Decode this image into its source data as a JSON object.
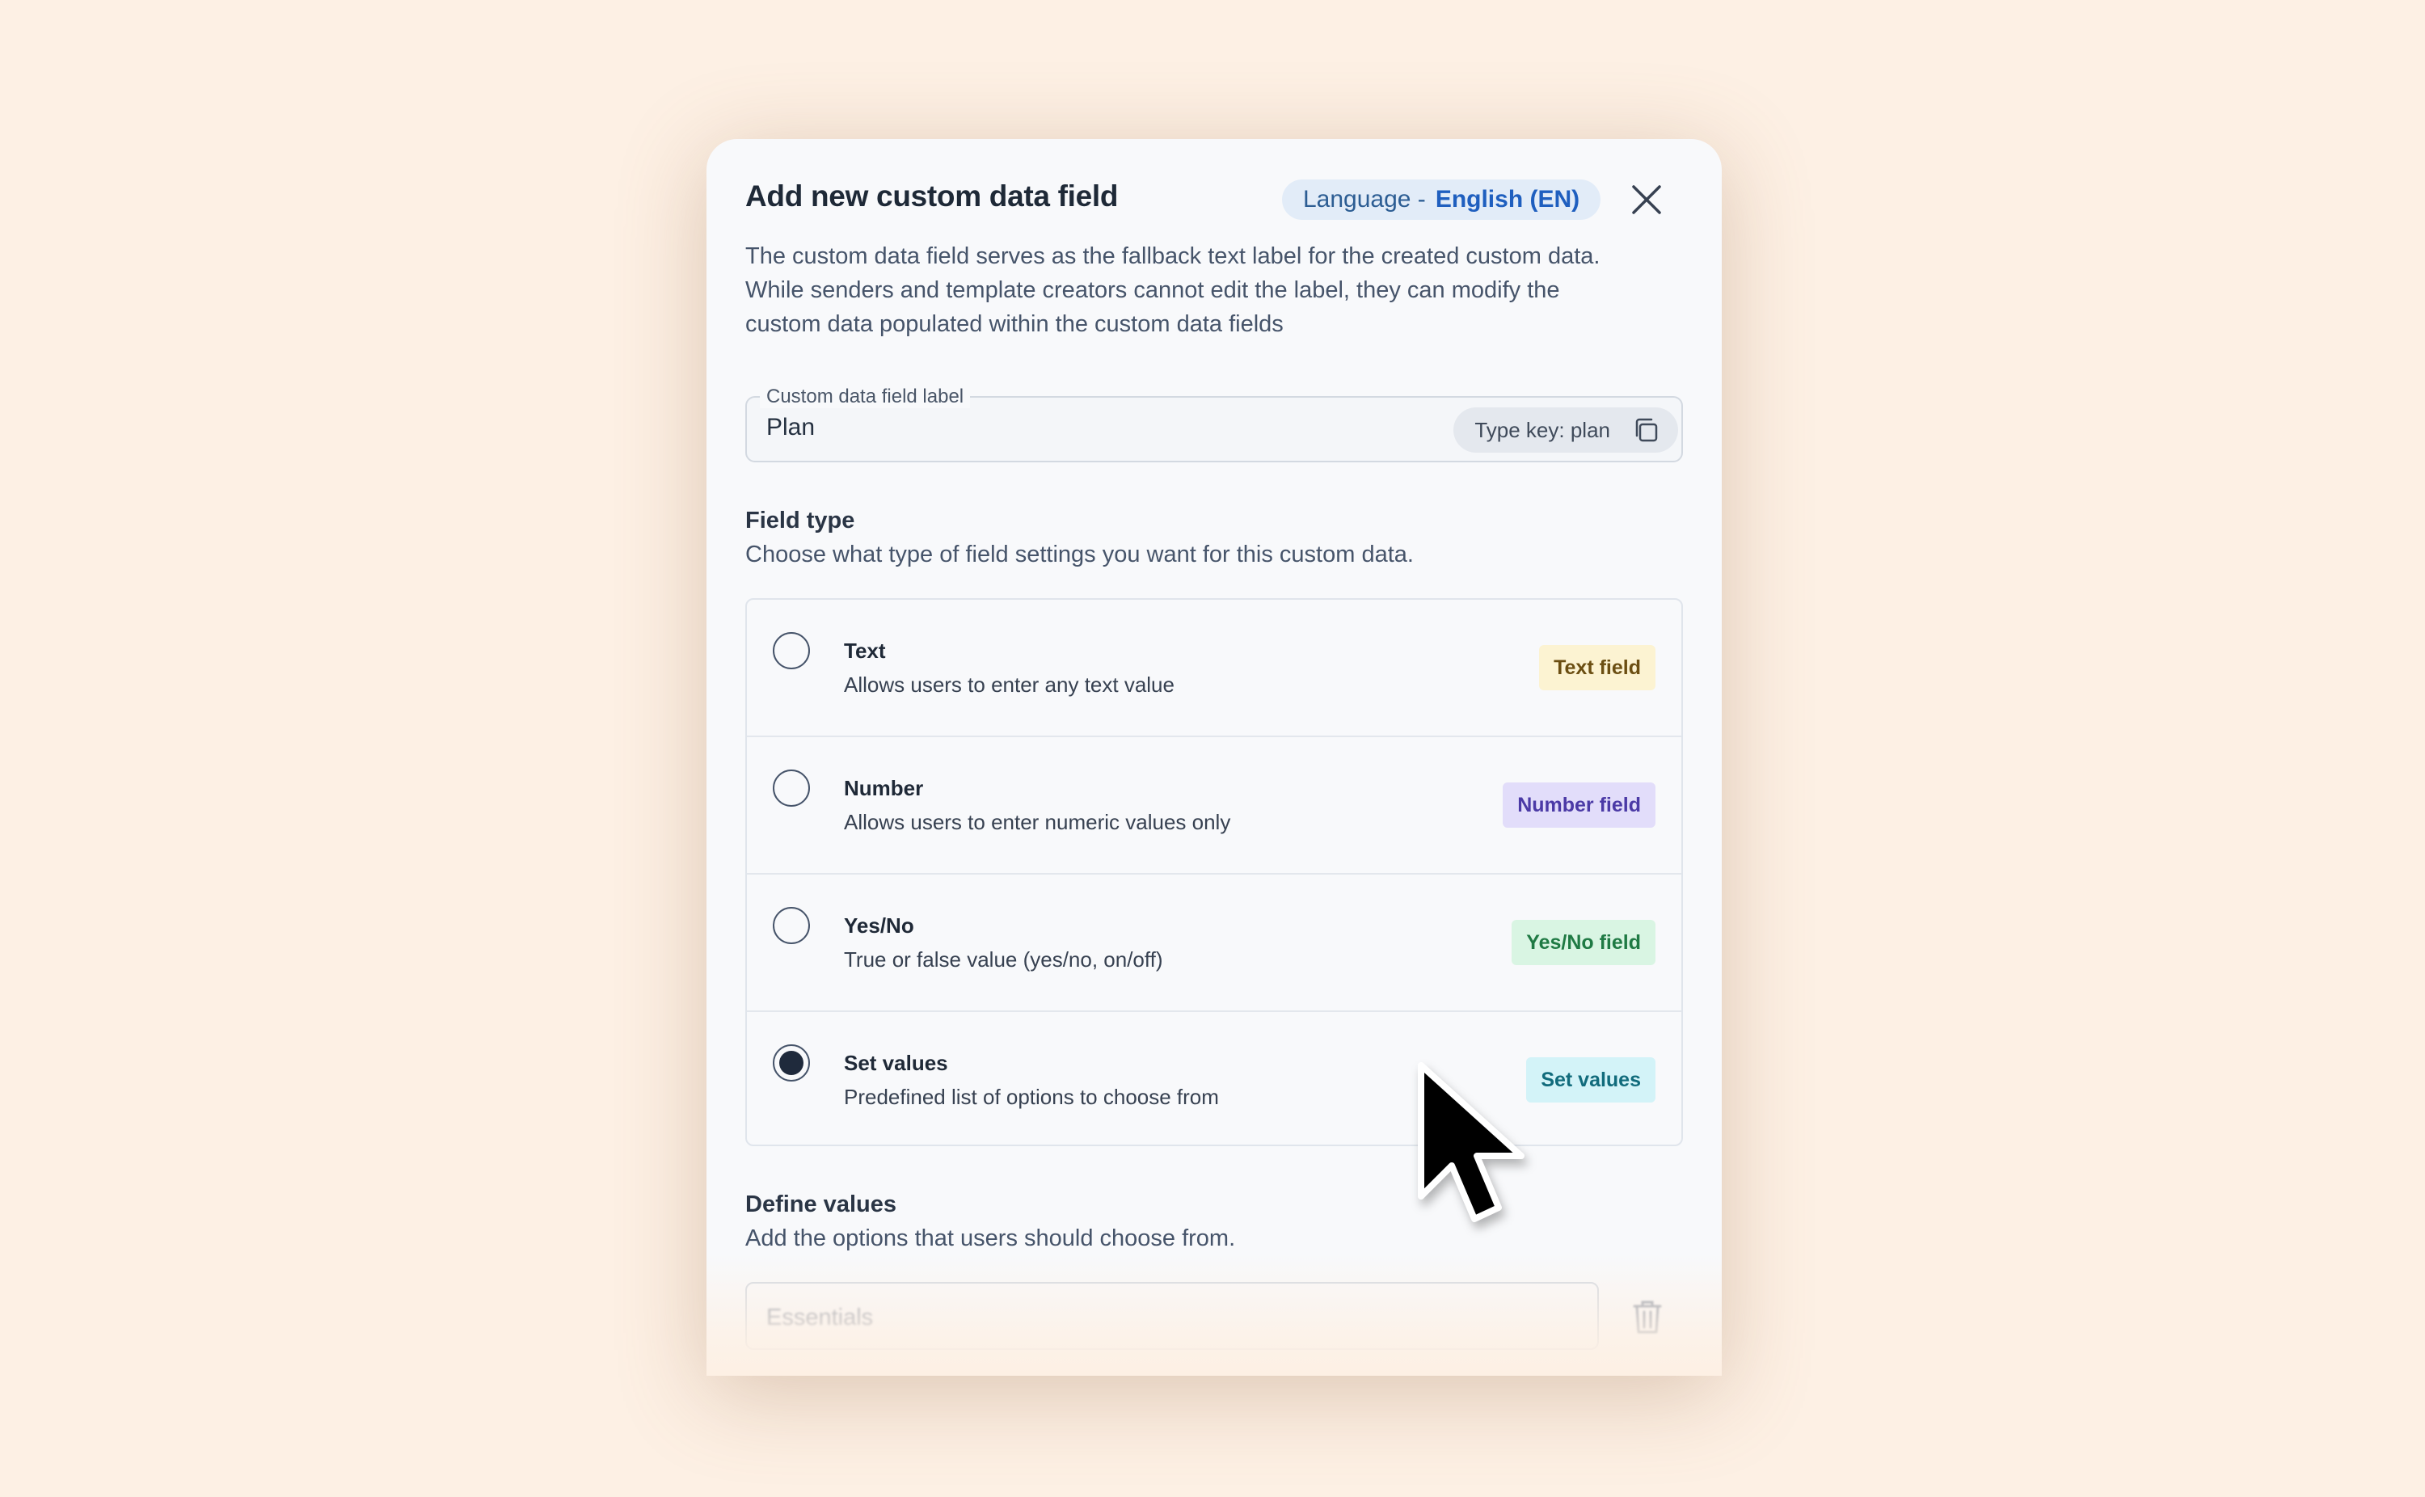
{
  "dialog": {
    "title": "Add new custom data field",
    "language": {
      "label": "Language -",
      "value": "English (EN)"
    },
    "description": "The custom data field serves as the fallback text label for the created custom data. While senders and template creators cannot edit the label, they can modify the custom data populated within the custom data fields"
  },
  "label_field": {
    "legend": "Custom data field label",
    "value": "Plan",
    "type_key": "Type key: plan"
  },
  "field_type": {
    "title": "Field type",
    "subtitle": "Choose what type of field settings you want for this custom data.",
    "options": [
      {
        "title": "Text",
        "description": "Allows users to enter any text value",
        "badge": "Text field",
        "badge_bg": "#fcf3d2",
        "badge_color": "#6b4e12",
        "selected": false
      },
      {
        "title": "Number",
        "description": "Allows users to enter numeric values only",
        "badge": "Number field",
        "badge_bg": "#e2ddfa",
        "badge_color": "#4b3aa6",
        "selected": false
      },
      {
        "title": "Yes/No",
        "description": "True or false value (yes/no, on/off)",
        "badge": "Yes/No field",
        "badge_bg": "#d9f5e3",
        "badge_color": "#1f7a44",
        "selected": false
      },
      {
        "title": "Set values",
        "description": "Predefined list of options to choose from",
        "badge": "Set values",
        "badge_bg": "#d3f3f8",
        "badge_color": "#116b7c",
        "selected": true
      }
    ]
  },
  "define_values": {
    "title": "Define values",
    "subtitle": "Add the options that users should choose from.",
    "first_value": "Essentials"
  },
  "icons": {
    "close": "close-icon",
    "copy": "copy-icon",
    "trash": "trash-icon",
    "cursor": "mouse-cursor-icon"
  }
}
